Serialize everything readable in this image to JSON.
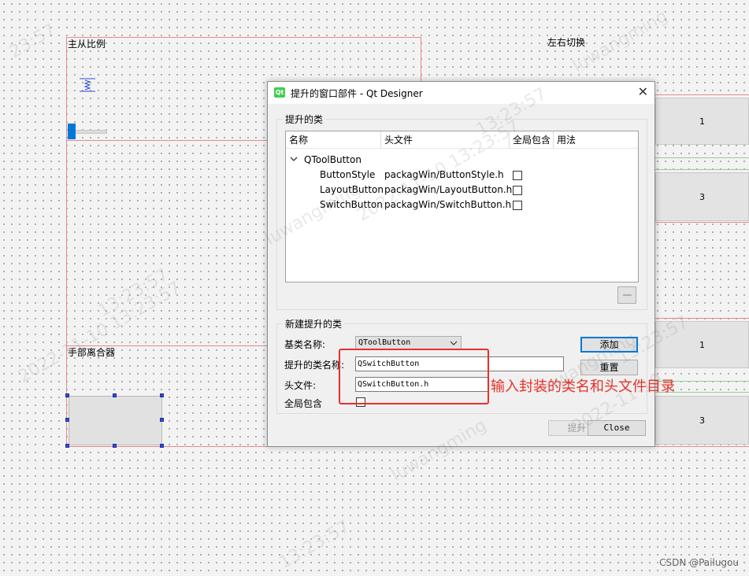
{
  "canvas": {
    "label_master_ratio": "主从比例",
    "label_left_right": "左右切换",
    "label_hand_clutch": "手部离合器",
    "panel_top": [
      "1",
      "3"
    ],
    "panel_bottom": [
      "1",
      "3"
    ]
  },
  "dialog": {
    "title": "提升的窗口部件 - Qt Designer",
    "icon_text": "Qt",
    "close_glyph": "✕",
    "promoted_group_title": "提升的类",
    "tree_headers": [
      "名称",
      "头文件",
      "全局包含",
      "用法"
    ],
    "tree_parent": "QToolButton",
    "tree_rows": [
      {
        "name": "ButtonStyle",
        "header": "packagWin/ButtonStyle.h",
        "global": false
      },
      {
        "name": "LayoutButton",
        "header": "packagWin/LayoutButton.h",
        "global": false
      },
      {
        "name": "SwitchButton",
        "header": "packagWin/SwitchButton.h",
        "global": false
      }
    ],
    "new_group_title": "新建提升的类",
    "base_class_label": "基类名称:",
    "base_class_value": "QToolButton",
    "promoted_name_label": "提升的类名称:",
    "promoted_name_value": "QSwitchButton",
    "header_file_label": "头文件:",
    "header_file_value": "QSwitchButton.h",
    "global_include_label": "全局包含",
    "add_button": "添加",
    "reset_button": "重置",
    "promote_button": "提升",
    "close_button": "Close"
  },
  "annotation": {
    "text": "输入封装的类名和头文件目录",
    "color": "#e8302a"
  },
  "watermark": {
    "texts": [
      "23:57",
      "luwangming",
      "13:23:57",
      "2022-11-10 13:23:57",
      "luwangming",
      "2022-11-10 13:23:57",
      "luwangming",
      "13:23:57",
      "luwangming",
      "2022-11-10",
      "13:23:57",
      "13:23:57"
    ]
  },
  "footer": "CSDN @Pailugou"
}
